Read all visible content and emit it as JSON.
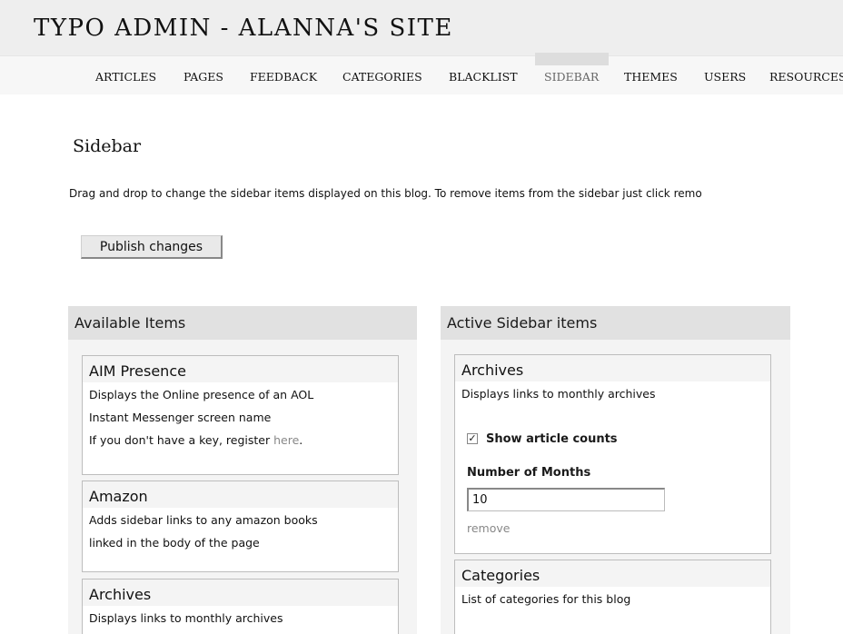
{
  "header": {
    "site_title": "TYPO ADMIN - ALANNA'S SITE",
    "nav": [
      "ARTICLES",
      "PAGES",
      "FEEDBACK",
      "CATEGORIES",
      "BLACKLIST",
      "SIDEBAR",
      "THEMES",
      "USERS",
      "RESOURCES"
    ],
    "active_nav": "SIDEBAR"
  },
  "main": {
    "title": "Sidebar",
    "intro": "Drag and drop to change the sidebar items displayed on this blog. To remove items from the sidebar just click remo",
    "publish_button": "Publish changes"
  },
  "available": {
    "heading": "Available Items",
    "items": [
      {
        "title": "AIM Presence",
        "lines": [
          "Displays the Online presence of an AOL",
          "Instant Messenger screen name"
        ],
        "key_text": "If you don't have a key, register ",
        "key_link": "here",
        "key_suffix": "."
      },
      {
        "title": "Amazon",
        "lines": [
          "Adds sidebar links to any amazon books",
          "linked in the body of the page"
        ]
      },
      {
        "title": "Archives",
        "lines": [
          "Displays links to monthly archives"
        ]
      }
    ]
  },
  "active": {
    "heading": "Active Sidebar items",
    "archives": {
      "title": "Archives",
      "description": "Displays links to monthly archives",
      "checkbox_label": "Show article counts",
      "checkbox_checked": true,
      "months_label": "Number of Months",
      "months_value": "10",
      "remove_label": "remove"
    },
    "categories": {
      "title": "Categories",
      "description": "List of categories for this blog"
    }
  }
}
